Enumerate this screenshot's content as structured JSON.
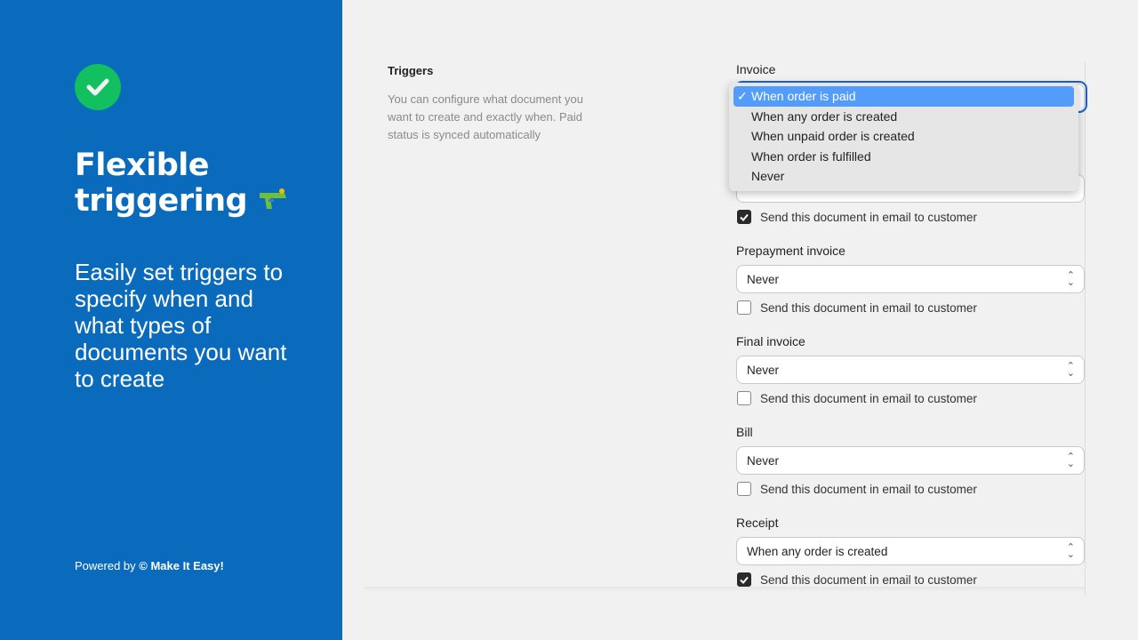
{
  "left": {
    "title_line1": "Flexible",
    "title_line2": "triggering",
    "subtitle": "Easily set triggers to specify when and what types of documents you want to create",
    "powered_prefix": "Powered by",
    "powered_brand": "© Make It Easy!",
    "accent": "#0a6bbd"
  },
  "triggers": {
    "title": "Triggers",
    "description": "You can configure what document you want to create and exactly when. Paid status is synced automatically"
  },
  "invoice": {
    "label": "Invoice",
    "options": [
      "When order is paid",
      "When any order is created",
      "When unpaid order is created",
      "When order is fulfilled",
      "Never"
    ],
    "selected": "When order is paid",
    "checkmark": "✓"
  },
  "email_label": "Send this document in email to customer",
  "fields": [
    {
      "label": "",
      "value": "",
      "email": true
    },
    {
      "label": "Prepayment invoice",
      "value": "Never",
      "email": false
    },
    {
      "label": "Final invoice",
      "value": "Never",
      "email": false
    },
    {
      "label": "Bill",
      "value": "Never",
      "email": false
    },
    {
      "label": "Receipt",
      "value": "When any order is created",
      "email": true
    }
  ]
}
